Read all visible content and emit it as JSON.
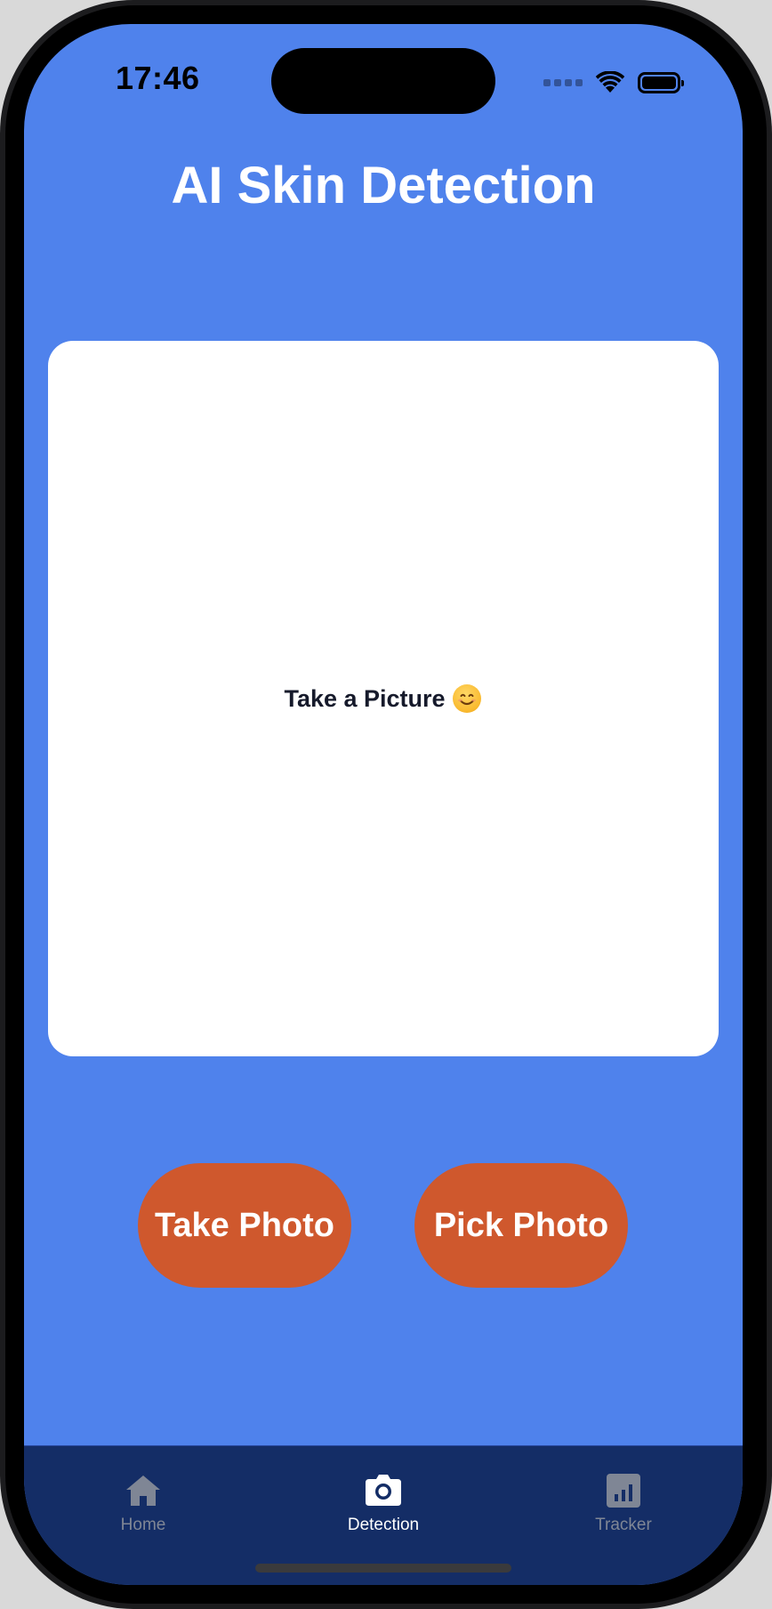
{
  "status_bar": {
    "time": "17:46",
    "icons": [
      "signal-dots-icon",
      "wifi-icon",
      "battery-icon"
    ]
  },
  "header": {
    "title": "AI Skin Detection"
  },
  "photo_area": {
    "placeholder_text": "Take a Picture",
    "emoji": "smiling-face-icon"
  },
  "actions": {
    "take_photo_label": "Take Photo",
    "pick_photo_label": "Pick Photo"
  },
  "tabbar": {
    "selected": "Detection",
    "items": [
      {
        "label": "Home",
        "icon": "home-icon"
      },
      {
        "label": "Detection",
        "icon": "camera-icon"
      },
      {
        "label": "Tracker",
        "icon": "bar-chart-icon"
      }
    ]
  },
  "colors": {
    "background": "#4f82ec",
    "button": "#cf582d",
    "tabbar": "#142d66",
    "tab_inactive": "#7f8695",
    "tab_active": "#ffffff"
  }
}
